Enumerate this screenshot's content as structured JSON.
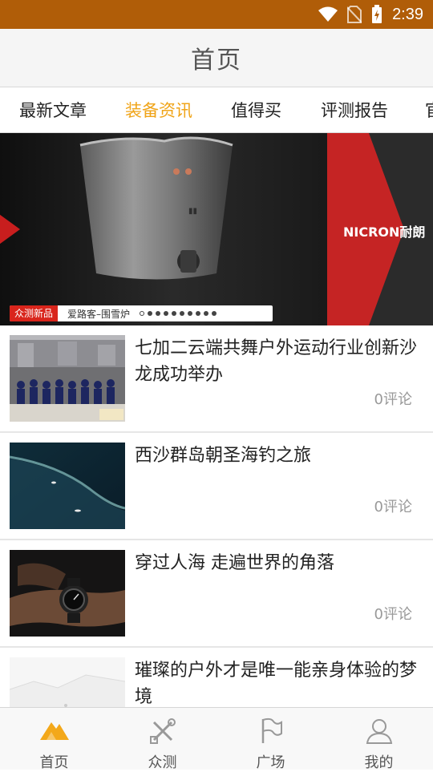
{
  "status": {
    "time": "2:39"
  },
  "header": {
    "title": "首页"
  },
  "tabs": [
    {
      "label": "最新文章"
    },
    {
      "label": "装备资讯"
    },
    {
      "label": "值得买"
    },
    {
      "label": "评测报告"
    },
    {
      "label": "官"
    }
  ],
  "active_tab": "装备资讯",
  "banner": {
    "tag": "众测新品",
    "caption": "爱路客–围雪炉",
    "brand": "NICRON耐朗",
    "slide_count": 10,
    "active_slide": 1
  },
  "news": [
    {
      "title": "七加二云端共舞户外运动行业创新沙龙成功举办",
      "comments": "0评论",
      "image": "group-photo"
    },
    {
      "title": "西沙群岛朝圣海钓之旅",
      "comments": "0评论",
      "image": "ocean-aerial"
    },
    {
      "title": "穿过人海 走遍世界的角落",
      "comments": "0评论",
      "image": "wrist-watch"
    },
    {
      "title": "璀璨的户外才是唯一能亲身体验的梦境",
      "comments": "",
      "image": "snow-landscape"
    }
  ],
  "bottom_nav": [
    {
      "label": "首页",
      "icon": "home-mountain-icon",
      "active": true
    },
    {
      "label": "众测",
      "icon": "tools-icon",
      "active": false
    },
    {
      "label": "广场",
      "icon": "flag-icon",
      "active": false
    },
    {
      "label": "我的",
      "icon": "person-icon",
      "active": false
    }
  ],
  "colors": {
    "status_bar": "#b05d08",
    "accent": "#f0a418",
    "banner_red": "#c52424"
  }
}
